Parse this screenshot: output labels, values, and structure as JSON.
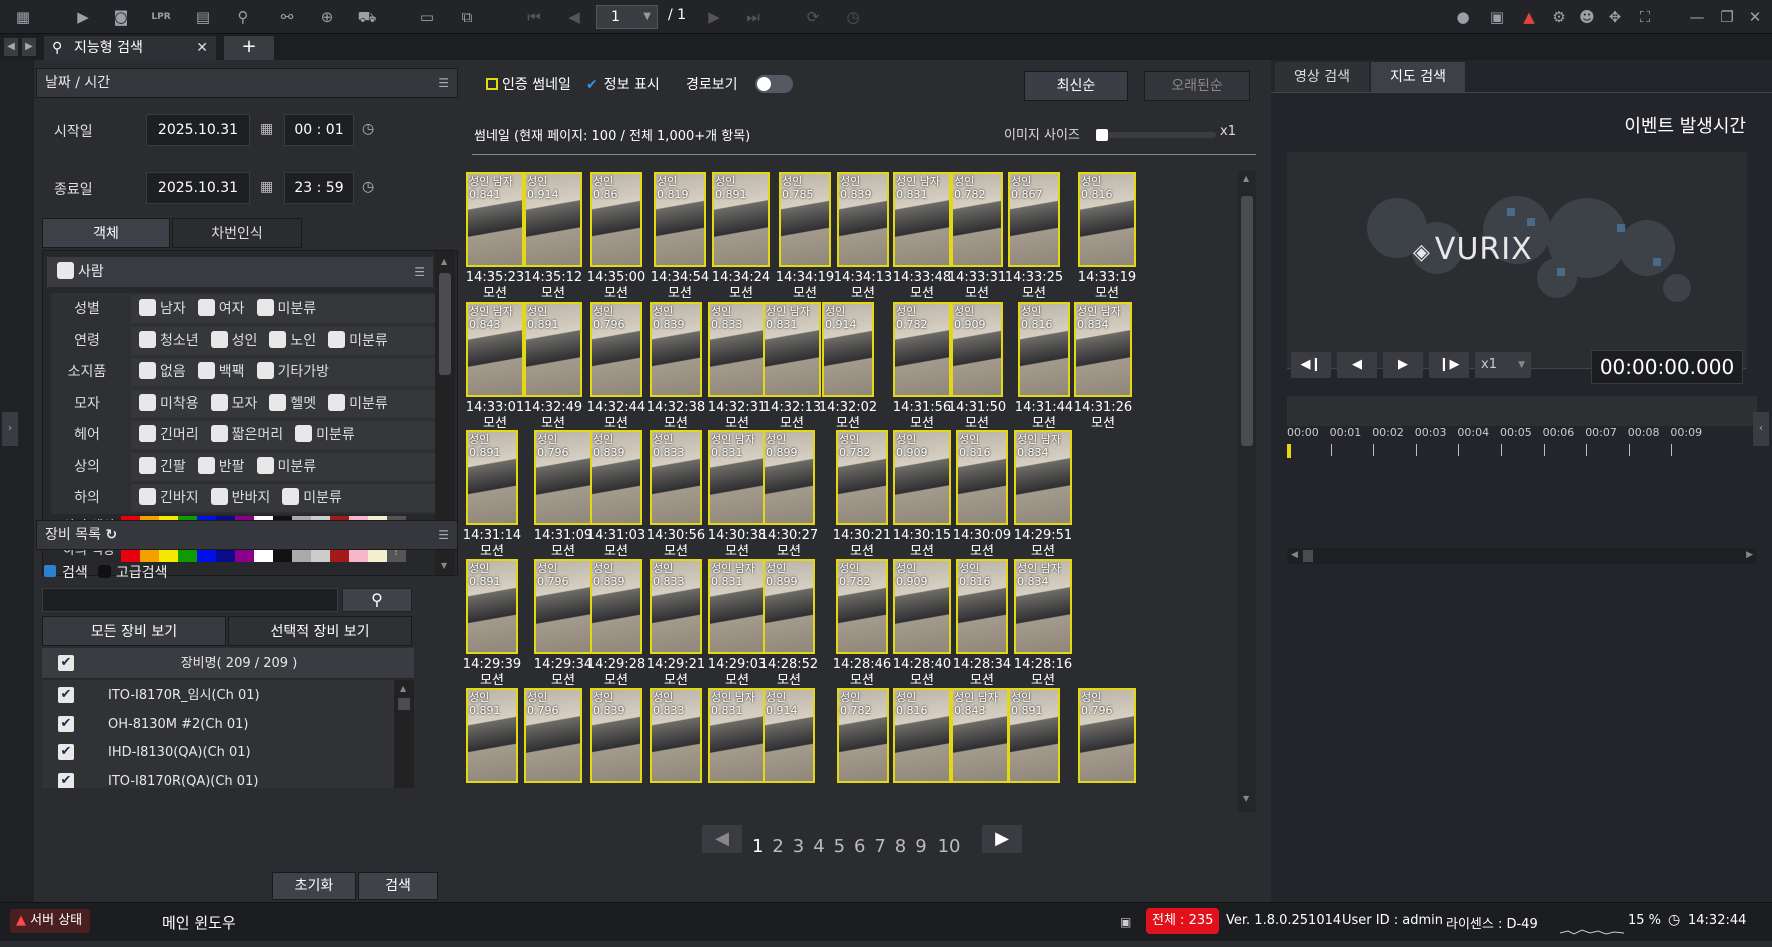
{
  "toolbar": {
    "page_current": "1",
    "page_total": "/ 1"
  },
  "tabs": {
    "main_tab": "지능형 검색",
    "add": "+"
  },
  "left": {
    "datetime_header": "날짜 / 시간",
    "start_label": "시작일",
    "start_date": "2025.10.31",
    "start_time": "00 : 01",
    "end_label": "종료일",
    "end_date": "2025.10.31",
    "end_time": "23 : 59",
    "tab_object": "객체",
    "tab_plate": "차번인식",
    "person_header": "사람",
    "filters": [
      {
        "label": "성별",
        "opts": [
          "남자",
          "여자",
          "미분류"
        ]
      },
      {
        "label": "연령",
        "opts": [
          "청소년",
          "성인",
          "노인",
          "미분류"
        ]
      },
      {
        "label": "소지품",
        "opts": [
          "없음",
          "백팩",
          "기타가방"
        ]
      },
      {
        "label": "모자",
        "opts": [
          "미착용",
          "모자",
          "헬멧",
          "미분류"
        ]
      },
      {
        "label": "헤어",
        "opts": [
          "긴머리",
          "짧은머리",
          "미분류"
        ]
      },
      {
        "label": "상의",
        "opts": [
          "긴팔",
          "반팔",
          "미분류"
        ]
      },
      {
        "label": "하의",
        "opts": [
          "긴바지",
          "반바지",
          "미분류"
        ]
      }
    ],
    "top_color_label": "상의 색상",
    "bottom_color_label": "하의 색상",
    "colors": [
      "#e8000c",
      "#f2a100",
      "#f7e800",
      "#0e9b00",
      "#0011e8",
      "#0a0a8a",
      "#8a008a",
      "#ffffff",
      "#111111",
      "#aaaaaa",
      "#cccccc",
      "#a31a1a",
      "#f7b6c9",
      "#f4efcf"
    ],
    "device_header": "장비 목록",
    "search_radio": "검색",
    "adv_radio": "고급검색",
    "tab_all": "모든 장비 보기",
    "tab_sel": "선택적 장비 보기",
    "device_col": "장비명( 209 / 209 )",
    "devices": [
      "ITO-I8170R_임시(Ch 01)",
      "OH-8130M #2(Ch 01)",
      "IHD-I8130(QA)(Ch 01)",
      "ITO-I8170R(QA)(Ch 01)"
    ],
    "reset": "초기화",
    "search": "검색"
  },
  "mid": {
    "opt_thumb": "인증 썸네일",
    "opt_info": "정보 표시",
    "opt_route": "경로보기",
    "sort_new": "최신순",
    "sort_old": "오래된순",
    "summary": "썸네일 (현재 페이지: 100 / 전체 1,000+개 항목)",
    "img_size": "이미지 사이즈",
    "zoom": "x1",
    "rows": [
      [
        [
          "성인 남자 0.841",
          "14:35:23"
        ],
        [
          "성인 0.914",
          "14:35:12"
        ],
        [
          "성인 0.86",
          "14:35:00"
        ],
        [
          "성인 0.819",
          "14:34:54"
        ],
        [
          "성인 0.891",
          "14:34:24"
        ],
        [
          "성인 0.785",
          "14:34:19"
        ],
        [
          "성인 0.839",
          "14:34:13"
        ],
        [
          "성인 남자 0.831",
          "14:33:48"
        ],
        [
          "성인 0.782",
          "14:33:31"
        ],
        [
          "성인 0.867",
          "14:33:25"
        ],
        [
          "성인 0.816",
          "14:33:19"
        ]
      ],
      [
        [
          "성인 남자 0.843",
          "14:33:01"
        ],
        [
          "성인 0.891",
          "14:32:49"
        ],
        [
          "성인 0.796",
          "14:32:44"
        ],
        [
          "성인 0.839",
          "14:32:38"
        ],
        [
          "성인 0.833",
          "14:32:31"
        ],
        [
          "성인 남자 0.831",
          "14:32:13"
        ],
        [
          "성인 0.914",
          "14:32:02"
        ],
        [
          "성인 0.782",
          "14:31:56"
        ],
        [
          "성인 0.909",
          "14:31:50"
        ],
        [
          "성인 0.816",
          "14:31:44"
        ],
        [
          "성인 남자 0.834",
          "14:31:26"
        ]
      ],
      [
        [
          "성인 0.891",
          "14:31:14"
        ],
        [
          "성인 0.796",
          "14:31:09"
        ],
        [
          "성인 0.839",
          "14:31:03"
        ],
        [
          "성인 0.833",
          "14:30:56"
        ],
        [
          "성인 남자 0.831",
          "14:30:38"
        ],
        [
          "성인 0.899",
          "14:30:27"
        ],
        [
          "성인 0.782",
          "14:30:21"
        ],
        [
          "성인 0.909",
          "14:30:15"
        ],
        [
          "성인 0.816",
          "14:30:09"
        ],
        [
          "성인 남자 0.834",
          "14:29:51"
        ]
      ],
      [
        [
          "성인 0.891",
          "14:29:39"
        ],
        [
          "성인 0.796",
          "14:29:34"
        ],
        [
          "성인 0.839",
          "14:29:28"
        ],
        [
          "성인 0.833",
          "14:29:21"
        ],
        [
          "성인 남자 0.831",
          "14:29:03"
        ],
        [
          "성인 0.899",
          "14:28:52"
        ],
        [
          "성인 0.782",
          "14:28:46"
        ],
        [
          "성인 0.909",
          "14:28:40"
        ],
        [
          "성인 0.816",
          "14:28:34"
        ],
        [
          "성인 남자 0.834",
          "14:28:16"
        ]
      ],
      [
        [
          "성인 0.891",
          ""
        ],
        [
          "성인 0.796",
          ""
        ],
        [
          "성인 0.839",
          ""
        ],
        [
          "성인 0.833",
          ""
        ],
        [
          "성인 남자 0.831",
          ""
        ],
        [
          "성인 0.914",
          ""
        ],
        [
          "성인 0.782",
          ""
        ],
        [
          "성인 0.816",
          ""
        ],
        [
          "성인 남자 0.843",
          ""
        ],
        [
          "성인 0.891",
          ""
        ],
        [
          "성인 0.796",
          ""
        ]
      ]
    ],
    "event_label": "모션",
    "pages": [
      "1",
      "2",
      "3",
      "4",
      "5",
      "6",
      "7",
      "8",
      "9",
      "10"
    ]
  },
  "right": {
    "tab_video": "영상 검색",
    "tab_map": "지도 검색",
    "event_time": "이벤트 발생시간",
    "logo": "VURIX",
    "speed": "x1",
    "timecode": "00:00:00.000",
    "timeline": [
      "00:00",
      "00:01",
      "00:02",
      "00:03",
      "00:04",
      "00:05",
      "00:06",
      "00:07",
      "00:08",
      "00:09"
    ]
  },
  "status": {
    "server": "서버 상태",
    "main_window": "메인 윈도우",
    "total": "전체 : 235",
    "version": "Ver. 1.8.0.251014",
    "user": "User ID : admin",
    "license": "라이센스 : D-49",
    "cpu": "15 %",
    "time": "14:32:44"
  }
}
